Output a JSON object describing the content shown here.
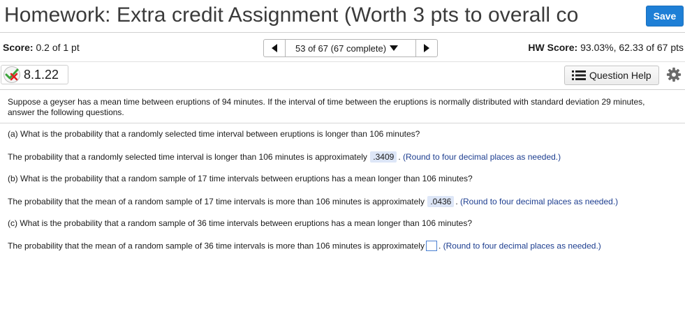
{
  "header": {
    "title": "Homework: Extra credit Assignment (Worth 3 pts to overall co",
    "save_label": "Save"
  },
  "status": {
    "score_label": "Score:",
    "score_value": "0.2 of 1 pt",
    "nav_current": "53 of 67 (67 complete)",
    "hw_score_label": "HW Score:",
    "hw_score_value": "93.03%, 62.33 of 67 pts"
  },
  "question": {
    "number": "8.1.22",
    "help_label": "Question Help",
    "intro": "Suppose a geyser has a mean time between eruptions of 94 minutes. If the interval of time between the eruptions is normally distributed with standard deviation 29 minutes, answer the following questions.",
    "parts": [
      {
        "question": "(a) What is the probability that a randomly selected time interval between eruptions is longer than 106 minutes?",
        "answer_prefix": "The probability that a randomly selected time interval is longer than 106 minutes is approximately",
        "answer_value": ".3409",
        "hint": "(Round to four decimal places as needed.)"
      },
      {
        "question": "(b) What is the probability that a random sample of 17 time intervals between eruptions has a mean longer than 106 minutes?",
        "answer_prefix": "The probability that the mean of a random sample of 17 time intervals is more than 106 minutes is approximately",
        "answer_value": ".0436",
        "hint": "(Round to four decimal places as needed.)"
      },
      {
        "question": "(c) What is the probability that a random sample of 36 time intervals between eruptions has a mean longer than 106 minutes?",
        "answer_prefix": "The probability that the mean of a random sample of 36 time intervals is more than 106 minutes is approximately",
        "answer_value": "",
        "hint": "(Round to four decimal places as needed.)"
      }
    ]
  },
  "colors": {
    "save_button": "#1e7fd6",
    "answer_highlight": "#dde6f7",
    "hint_text": "#1c3d8f"
  },
  "icons": [
    "partial-credit-icon",
    "list-icon",
    "gear-icon",
    "arrow-left-icon",
    "arrow-right-icon",
    "dropdown-arrow-icon"
  ]
}
